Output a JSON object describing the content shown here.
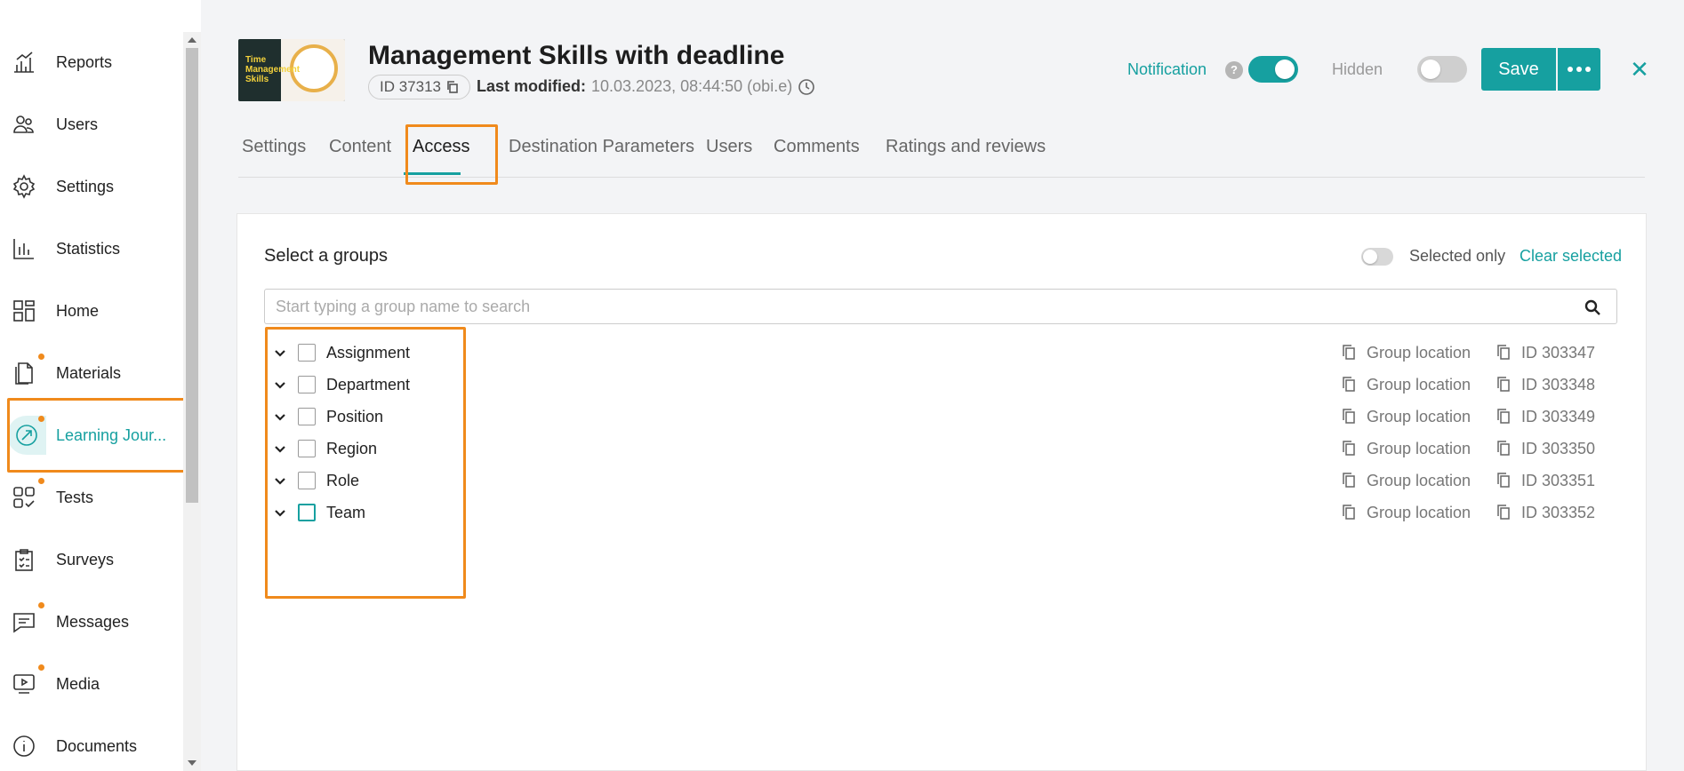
{
  "sidebar": {
    "items": [
      {
        "label": "Reports",
        "icon": "chart-up-icon",
        "dot": false
      },
      {
        "label": "Users",
        "icon": "users-icon",
        "dot": false
      },
      {
        "label": "Settings",
        "icon": "gear-icon",
        "dot": false
      },
      {
        "label": "Statistics",
        "icon": "bar-chart-icon",
        "dot": false
      },
      {
        "label": "Home",
        "icon": "layout-icon",
        "dot": false
      },
      {
        "label": "Materials",
        "icon": "documents-icon",
        "dot": true
      },
      {
        "label": "Learning Jour...",
        "icon": "learning-journey-icon",
        "dot": true,
        "active": true
      },
      {
        "label": "Tests",
        "icon": "tests-icon",
        "dot": true
      },
      {
        "label": "Surveys",
        "icon": "clipboard-icon",
        "dot": false
      },
      {
        "label": "Messages",
        "icon": "message-icon",
        "dot": true
      },
      {
        "label": "Media",
        "icon": "media-icon",
        "dot": true
      },
      {
        "label": "Documents",
        "icon": "info-icon",
        "dot": false
      }
    ]
  },
  "header": {
    "cover_text": "Time Management Skills",
    "title": "Management Skills with deadline",
    "id_label": "ID 37313",
    "modified_label": "Last modified:",
    "modified_value": "10.03.2023, 08:44:50 (obi.e)",
    "notification_label": "Notification",
    "help_glyph": "?",
    "hidden_label": "Hidden",
    "save_label": "Save",
    "close_glyph": "✕"
  },
  "tabs": [
    {
      "label": "Settings"
    },
    {
      "label": "Content"
    },
    {
      "label": "Access",
      "active": true
    },
    {
      "label": "Destination Parameters"
    },
    {
      "label": "Users"
    },
    {
      "label": "Comments"
    },
    {
      "label": "Ratings and reviews"
    }
  ],
  "access": {
    "title": "Select a groups",
    "selected_only_label": "Selected only",
    "clear_selected_label": "Clear selected",
    "search_placeholder": "Start typing a group name to search",
    "search_value": "",
    "groups": [
      {
        "name": "Assignment",
        "location": "Group location",
        "id": "ID 303347"
      },
      {
        "name": "Department",
        "location": "Group location",
        "id": "ID 303348"
      },
      {
        "name": "Position",
        "location": "Group location",
        "id": "ID 303349"
      },
      {
        "name": "Region",
        "location": "Group location",
        "id": "ID 303350"
      },
      {
        "name": "Role",
        "location": "Group location",
        "id": "ID 303351"
      },
      {
        "name": "Team",
        "location": "Group location",
        "id": "ID 303352"
      }
    ]
  },
  "colors": {
    "accent": "#16a0a0",
    "highlight": "#f08a1c"
  }
}
